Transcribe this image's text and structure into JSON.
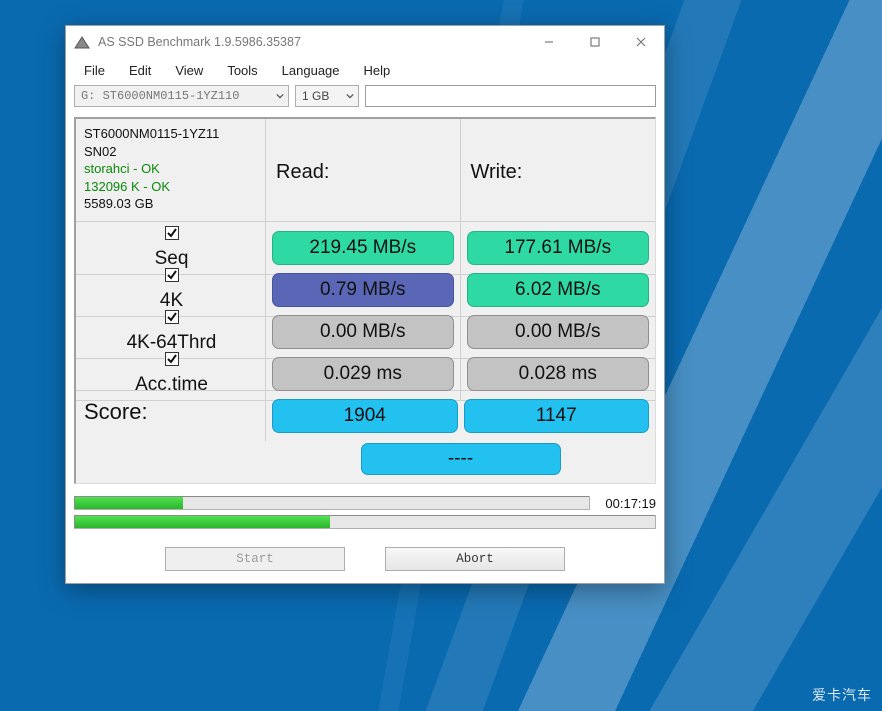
{
  "window": {
    "title": "AS SSD Benchmark 1.9.5986.35387"
  },
  "menu": {
    "items": [
      "File",
      "Edit",
      "View",
      "Tools",
      "Language",
      "Help"
    ]
  },
  "toolbar": {
    "drive_selected": "G: ST6000NM0115-1YZ110",
    "size_selected": "1 GB",
    "text_input_value": ""
  },
  "device": {
    "model": "ST6000NM0115-1YZ11",
    "firmware": "SN02",
    "driver_status": "storahci - OK",
    "alignment_status": "132096 K - OK",
    "capacity": "5589.03 GB"
  },
  "headers": {
    "read": "Read:",
    "write": "Write:"
  },
  "tests": {
    "seq": {
      "label": "Seq",
      "checked": true,
      "read": "219.45 MB/s",
      "write": "177.61 MB/s",
      "read_style": "green",
      "write_style": "green"
    },
    "k4": {
      "label": "4K",
      "checked": true,
      "read": "0.79 MB/s",
      "write": "6.02 MB/s",
      "read_style": "blue",
      "write_style": "green"
    },
    "k4_64": {
      "label": "4K-64Thrd",
      "checked": true,
      "read": "0.00 MB/s",
      "write": "0.00 MB/s",
      "read_style": "gray",
      "write_style": "gray"
    },
    "acc": {
      "label": "Acc.time",
      "checked": true,
      "read": "0.029 ms",
      "write": "0.028 ms",
      "read_style": "gray",
      "write_style": "gray"
    }
  },
  "score": {
    "label": "Score:",
    "read": "1904",
    "write": "1147",
    "total": "----"
  },
  "progress": {
    "overall_percent": 21,
    "current_percent": 44,
    "elapsed": "00:17:19"
  },
  "buttons": {
    "start": "Start",
    "abort": "Abort",
    "start_enabled": false,
    "abort_enabled": true
  },
  "watermark": "爱卡汽车"
}
